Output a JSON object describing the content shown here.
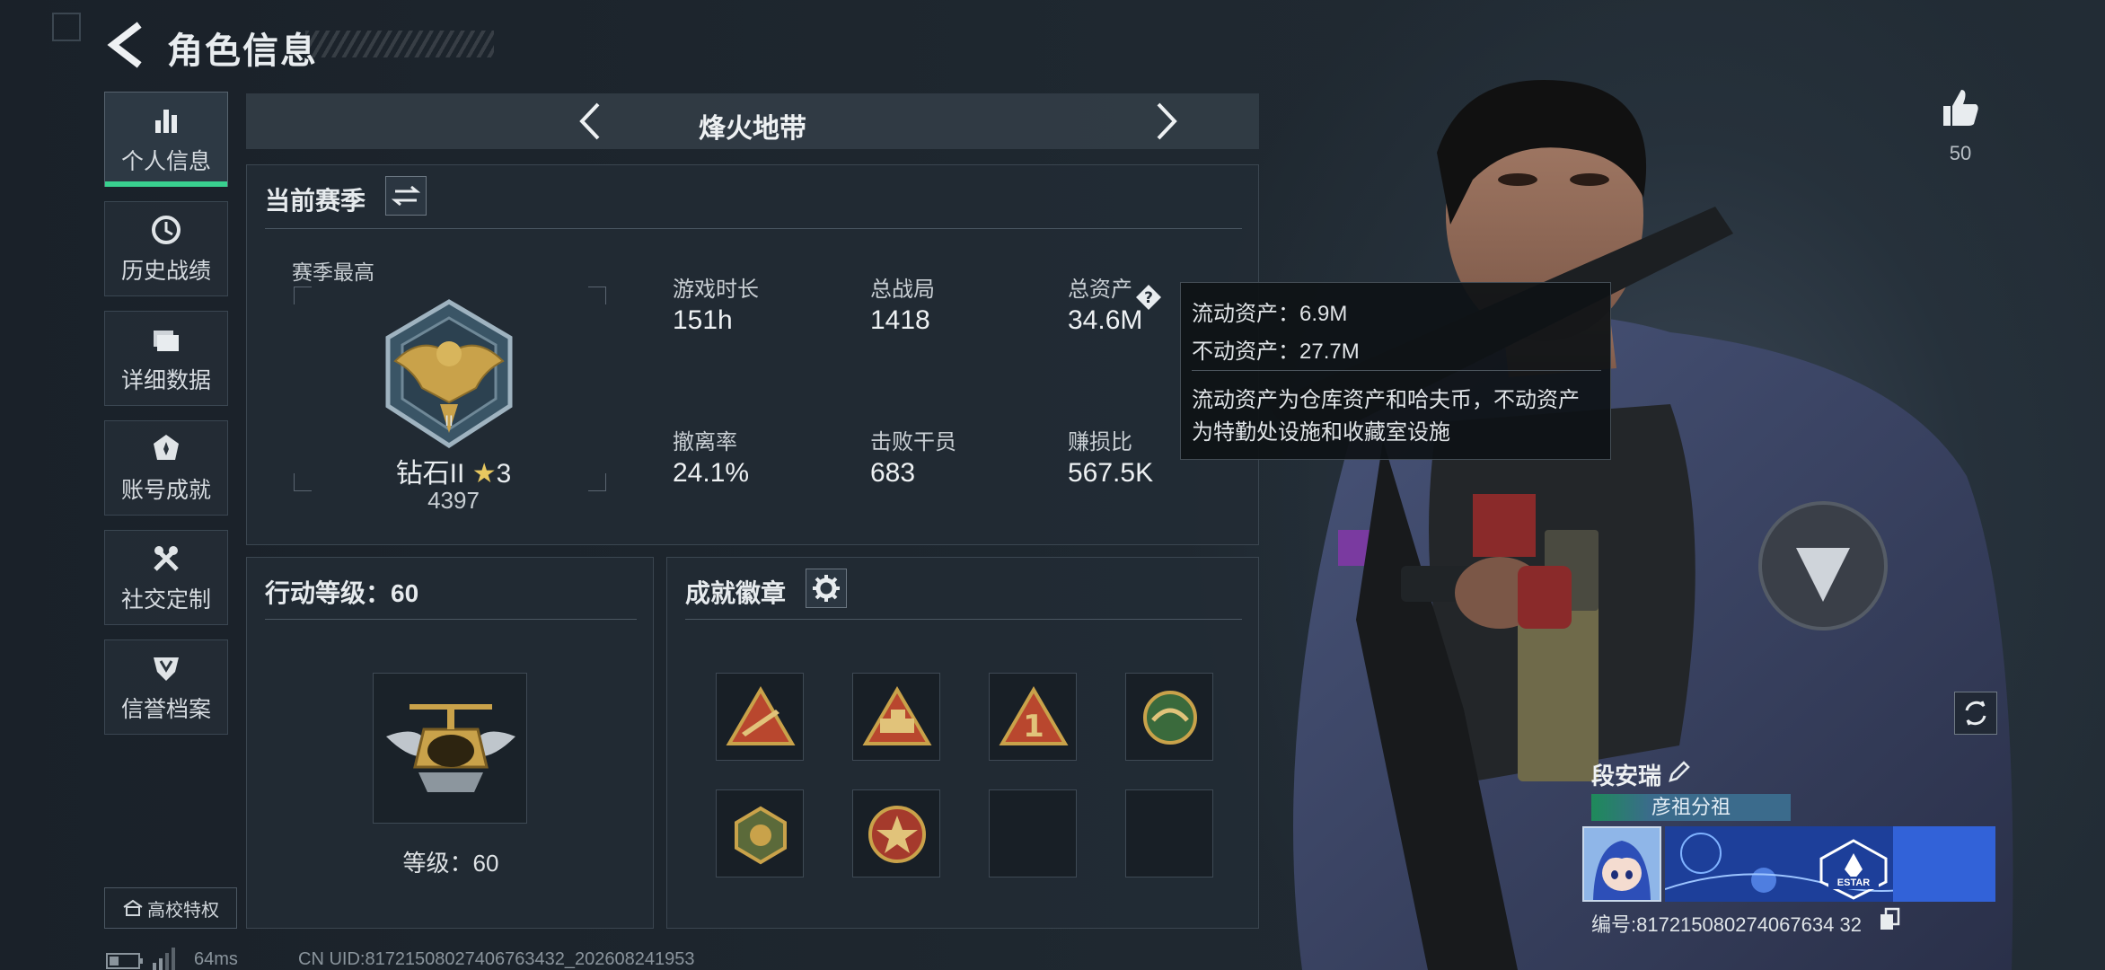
{
  "header": {
    "title": "角色信息"
  },
  "sidebar": {
    "items": [
      {
        "label": "个人信息",
        "icon": "bar-chart-icon",
        "active": true
      },
      {
        "label": "历史战绩",
        "icon": "history-icon",
        "active": false
      },
      {
        "label": "详细数据",
        "icon": "folder-icon",
        "active": false
      },
      {
        "label": "账号成就",
        "icon": "achievement-icon",
        "active": false
      },
      {
        "label": "社交定制",
        "icon": "tools-icon",
        "active": false
      },
      {
        "label": "信誉档案",
        "icon": "credit-shield-icon",
        "active": false
      }
    ],
    "campus_label": "高校特权"
  },
  "mode_bar": {
    "label": "烽火地带"
  },
  "season": {
    "title": "当前赛季",
    "subtitle": "赛季最高",
    "rank_name": "钻石II",
    "rank_stars": "3",
    "rank_score": "4397",
    "stats": [
      {
        "label": "游戏时长",
        "value": "151h"
      },
      {
        "label": "总战局",
        "value": "1418"
      },
      {
        "label": "总资产",
        "value": "34.6M"
      },
      {
        "label": "撤离率",
        "value": "24.1%"
      },
      {
        "label": "击败干员",
        "value": "683"
      },
      {
        "label": "赚损比",
        "value": "567.5K"
      }
    ]
  },
  "tooltip": {
    "liquid": "流动资产：6.9M",
    "fixed": "不动资产：27.7M",
    "note_line1": "流动资产为仓库资产和哈夫币，不动资产",
    "note_line2": "为特勤处设施和收藏室设施"
  },
  "level": {
    "title": "行动等级：60",
    "label": "等级：60"
  },
  "achievements": {
    "title": "成就徽章",
    "filled_slots": 6,
    "total_slots": 8
  },
  "player": {
    "likes": "50",
    "name": "段安瑞",
    "clan": "彦祖分祖",
    "card_text": "ESTAR",
    "uid_line": "编号:817215080274067634 32"
  },
  "footer": {
    "ping": "64ms",
    "uid": "CN UID:81721508027406763432_202608241953"
  },
  "colors": {
    "accent_green": "#39d08f",
    "gold": "#c9a24a",
    "panel_bg": "#222b34",
    "tooltip_bg": "#0e1216"
  }
}
